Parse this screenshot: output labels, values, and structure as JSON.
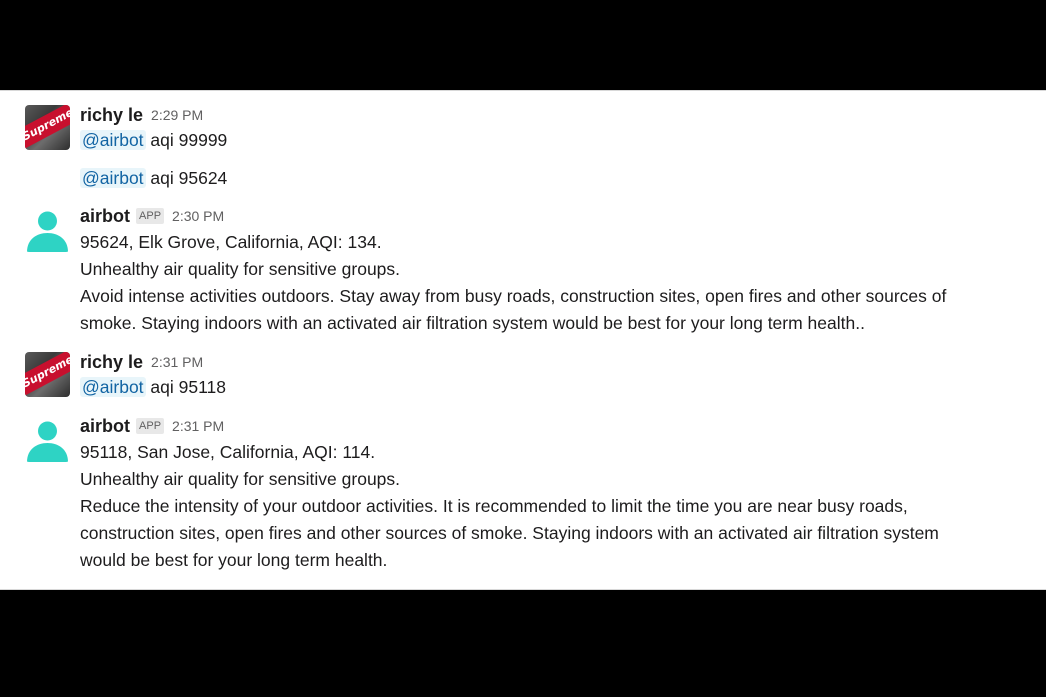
{
  "messages": [
    {
      "sender": "richy le",
      "time": "2:29 PM",
      "avatar": "supreme-logo-avatar",
      "lines": [
        {
          "mention": "@airbot",
          "text": " aqi 99999"
        },
        {
          "mention": "@airbot",
          "text": " aqi 95624"
        }
      ],
      "avatar_logo_text": "Supreme"
    },
    {
      "sender": "airbot",
      "badge": "APP",
      "time": "2:30 PM",
      "avatar": "person-icon",
      "lines": [
        "95624, Elk Grove, California, AQI: 134.",
        "Unhealthy air quality for sensitive groups.",
        "Avoid intense activities outdoors. Stay away from busy roads, construction sites, open fires and other sources of",
        "smoke. Staying indoors with an activated air filtration system would be best for your long term health.."
      ]
    },
    {
      "sender": "richy le",
      "time": "2:31 PM",
      "avatar": "supreme-logo-avatar",
      "lines": [
        {
          "mention": "@airbot",
          "text": " aqi 95118"
        }
      ],
      "avatar_logo_text": "Supreme"
    },
    {
      "sender": "airbot",
      "badge": "APP",
      "time": "2:31 PM",
      "avatar": "person-icon",
      "lines": [
        "95118, San Jose, California, AQI: 114.",
        "Unhealthy air quality for sensitive groups.",
        "Reduce the intensity of your outdoor activities. It is recommended to limit the time you are near busy roads,",
        "construction sites, open fires and other sources of smoke. Staying indoors with an activated air filtration system",
        "would be best for your long term health."
      ]
    }
  ],
  "colors": {
    "mention_bg": "#e8f5fa",
    "mention_text": "#1264a3",
    "bot_avatar": "#2ed3c4",
    "supreme_red": "#c8102e"
  }
}
